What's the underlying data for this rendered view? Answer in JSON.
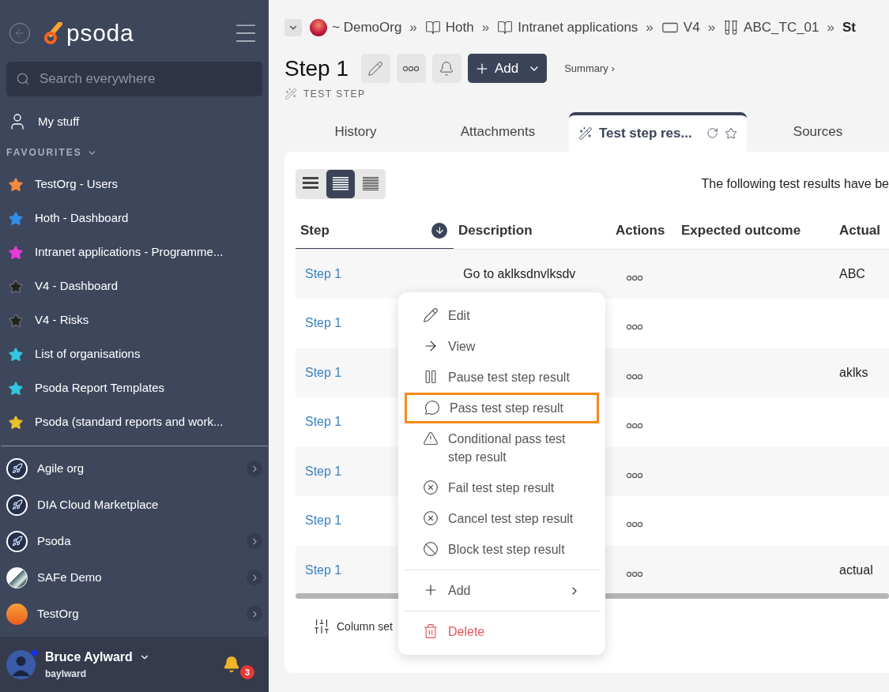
{
  "sidebar": {
    "logo": "psoda",
    "search": {
      "placeholder": "Search everywhere"
    },
    "my_stuff": "My stuff",
    "favourites_heading": "FAVOURITES",
    "favourites": [
      {
        "label": "TestOrg - Users",
        "color": "#f58a3c"
      },
      {
        "label": "Hoth - Dashboard",
        "color": "#2f8fe8"
      },
      {
        "label": "Intranet applications - Programme...",
        "color": "#e83ad6"
      },
      {
        "label": "V4 - Dashboard",
        "color": "#222222"
      },
      {
        "label": "V4 - Risks",
        "color": "#222222"
      },
      {
        "label": "List of organisations",
        "color": "#33c6e0"
      },
      {
        "label": "Psoda Report Templates",
        "color": "#33c6e0"
      },
      {
        "label": "Psoda (standard reports and work...",
        "color": "#e8c12a"
      }
    ],
    "organisations": [
      {
        "label": "Agile org",
        "kind": "rocket",
        "has_arrow": true
      },
      {
        "label": "DIA Cloud Marketplace",
        "kind": "rocket",
        "has_arrow": false
      },
      {
        "label": "Psoda",
        "kind": "rocket",
        "has_arrow": true
      },
      {
        "label": "SAFe Demo",
        "kind": "building",
        "has_arrow": true
      },
      {
        "label": "TestOrg",
        "kind": "sunset",
        "has_arrow": true
      }
    ],
    "user": {
      "name": "Bruce Aylward",
      "username": "baylward",
      "online": true,
      "notifications": "3"
    }
  },
  "breadcrumb": [
    {
      "label": "~ DemoOrg",
      "kind": "org"
    },
    {
      "label": "Hoth",
      "kind": "book"
    },
    {
      "label": "Intranet applications",
      "kind": "book"
    },
    {
      "label": "V4",
      "kind": "box"
    },
    {
      "label": "ABC_TC_01",
      "kind": "tubes"
    },
    {
      "label": "St",
      "kind": "current"
    }
  ],
  "breadcrumb_separator": "»",
  "title": "Step 1",
  "type_label": "TEST STEP",
  "add_button": "Add",
  "summary_link": "Summary ›",
  "tabs": [
    {
      "label": "History",
      "selected": false
    },
    {
      "label": "Attachments",
      "selected": false
    },
    {
      "label": "Test step res...",
      "selected": true
    },
    {
      "label": "Sources",
      "selected": false
    }
  ],
  "view_modes": [
    {
      "kind": "large",
      "selected": false
    },
    {
      "kind": "medium",
      "selected": true
    },
    {
      "kind": "compact",
      "selected": false
    }
  ],
  "notice": "The following test results have be",
  "table": {
    "columns": [
      "Step",
      "Description",
      "Actions",
      "Expected outcome",
      "Actual"
    ],
    "rows": [
      {
        "step": "Step 1",
        "description": "Go to aklksdnvlksdv",
        "expected": "",
        "actual": "ABC"
      },
      {
        "step": "Step 1",
        "description": "",
        "expected": "",
        "actual": ""
      },
      {
        "step": "Step 1",
        "description": "",
        "expected": "",
        "actual": "aklks"
      },
      {
        "step": "Step 1",
        "description": "",
        "expected": "",
        "actual": ""
      },
      {
        "step": "Step 1",
        "description": "",
        "expected": "",
        "actual": ""
      },
      {
        "step": "Step 1",
        "description": "",
        "expected": "",
        "actual": ""
      },
      {
        "step": "Step 1",
        "description": "",
        "expected": "",
        "actual": "actual"
      }
    ]
  },
  "column_settings": "Column set",
  "context_menu": [
    {
      "label": "Edit",
      "kind": "edit",
      "highlighted": false
    },
    {
      "label": "View",
      "kind": "view",
      "highlighted": false
    },
    {
      "label": "Pause test step result",
      "kind": "pause",
      "highlighted": false
    },
    {
      "label": "Pass test step result",
      "kind": "pass",
      "highlighted": true
    },
    {
      "label": "Conditional pass test step result",
      "kind": "warning",
      "highlighted": false
    },
    {
      "label": "Fail test step result",
      "kind": "fail",
      "highlighted": false
    },
    {
      "label": "Cancel test step result",
      "kind": "cancel",
      "highlighted": false
    },
    {
      "label": "Block test step result",
      "kind": "block",
      "highlighted": false
    },
    {
      "label": "Add",
      "kind": "add",
      "highlighted": false
    },
    {
      "label": "Delete",
      "kind": "delete",
      "highlighted": false
    }
  ]
}
